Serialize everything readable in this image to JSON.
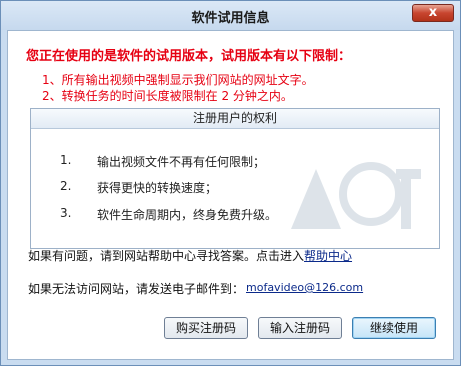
{
  "window": {
    "title": "软件试用信息",
    "close_label": "x"
  },
  "warning": {
    "title": "您正在使用的是软件的试用版本，试用版本有以下限制：",
    "limits": [
      "1、所有输出视频中强制显示我们网站的网址文字。",
      "2、转换任务的时间长度被限制在 2 分钟之内。"
    ]
  },
  "rights": {
    "header": "注册用户的权利",
    "items": [
      {
        "num": "1.",
        "text": "输出视频文件不再有任何限制；"
      },
      {
        "num": "2.",
        "text": "获得更快的转换速度；"
      },
      {
        "num": "3.",
        "text": "软件生命周期内，终身免费升级。"
      }
    ]
  },
  "help": {
    "prefix": "如果有问题，请到网站帮助中心寻找答案。点击进入",
    "link": "帮助中心"
  },
  "contact": {
    "prefix": "如果无法访问网站，请发送电子邮件到：",
    "email": "mofavideo@126.com"
  },
  "buttons": {
    "buy": "购买注册码",
    "enter": "输入注册码",
    "continue": "继续使用"
  },
  "colors": {
    "warning": "#e60012",
    "link": "#0b2a8a",
    "titlebar": "#c9dcf0"
  }
}
